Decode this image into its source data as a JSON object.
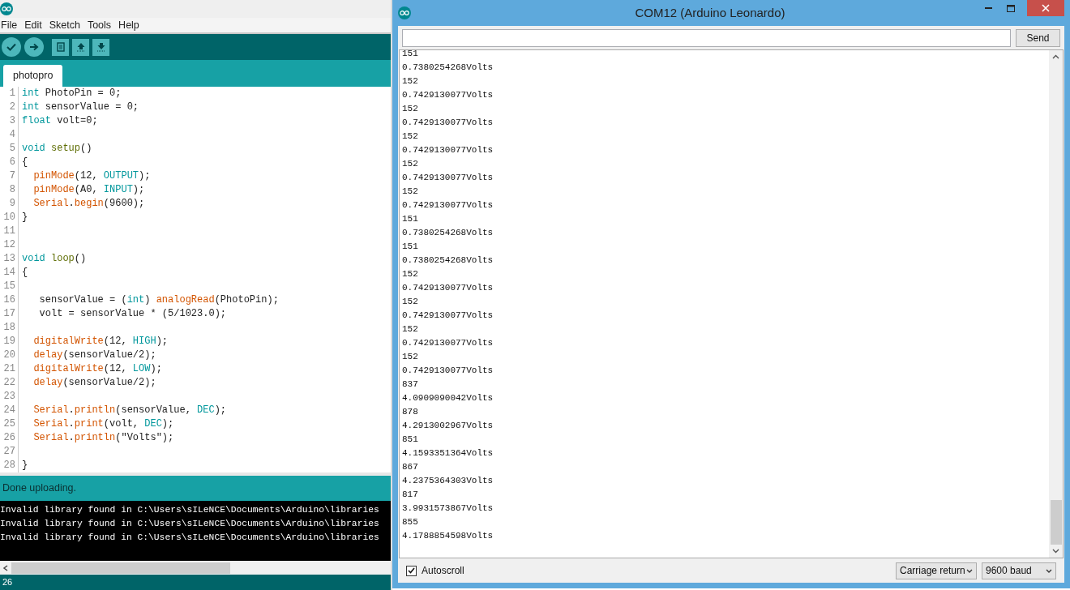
{
  "ide": {
    "menu": [
      "File",
      "Edit",
      "Sketch",
      "Tools",
      "Help"
    ],
    "tabs": [
      {
        "label": "photopro",
        "selected": true
      }
    ],
    "code": [
      {
        "number": "1",
        "tokens": [
          {
            "text": "int",
            "kind": "type"
          },
          {
            "text": " PhotoPin = 0;",
            "kind": "plain"
          }
        ]
      },
      {
        "number": "2",
        "tokens": [
          {
            "text": "int",
            "kind": "type"
          },
          {
            "text": " sensorValue = 0;",
            "kind": "plain"
          }
        ]
      },
      {
        "number": "3",
        "tokens": [
          {
            "text": "float",
            "kind": "type"
          },
          {
            "text": " volt=0;",
            "kind": "plain"
          }
        ]
      },
      {
        "number": "4"
      },
      {
        "number": "5",
        "tokens": [
          {
            "text": "void",
            "kind": "type"
          },
          {
            "text": " setup",
            "kind": "entry"
          },
          {
            "text": "()",
            "kind": "plain"
          }
        ]
      },
      {
        "number": "6",
        "tokens": [
          {
            "text": "{",
            "kind": "plain"
          }
        ]
      },
      {
        "number": "7",
        "tokens": [
          {
            "text": "  pinMode",
            "kind": "func"
          },
          {
            "text": "(12, ",
            "kind": "plain"
          },
          {
            "text": "OUTPUT",
            "kind": "const"
          },
          {
            "text": ");",
            "kind": "plain"
          }
        ]
      },
      {
        "number": "8",
        "tokens": [
          {
            "text": "  pinMode",
            "kind": "func"
          },
          {
            "text": "(A0, ",
            "kind": "plain"
          },
          {
            "text": "INPUT",
            "kind": "const"
          },
          {
            "text": ");",
            "kind": "plain"
          }
        ]
      },
      {
        "number": "9",
        "tokens": [
          {
            "text": "  Serial",
            "kind": "func"
          },
          {
            "text": ".",
            "kind": "plain"
          },
          {
            "text": "begin",
            "kind": "func"
          },
          {
            "text": "(9600);",
            "kind": "plain"
          }
        ]
      },
      {
        "number": "10",
        "tokens": [
          {
            "text": "}",
            "kind": "plain"
          }
        ]
      },
      {
        "number": "11"
      },
      {
        "number": "12"
      },
      {
        "number": "13",
        "tokens": [
          {
            "text": "void",
            "kind": "type"
          },
          {
            "text": " loop",
            "kind": "entry"
          },
          {
            "text": "()",
            "kind": "plain"
          }
        ]
      },
      {
        "number": "14",
        "tokens": [
          {
            "text": "{",
            "kind": "plain"
          }
        ]
      },
      {
        "number": "15"
      },
      {
        "number": "16",
        "tokens": [
          {
            "text": "   sensorValue = (",
            "kind": "plain"
          },
          {
            "text": "int",
            "kind": "type"
          },
          {
            "text": ") ",
            "kind": "plain"
          },
          {
            "text": "analogRead",
            "kind": "func"
          },
          {
            "text": "(PhotoPin);",
            "kind": "plain"
          }
        ]
      },
      {
        "number": "17",
        "tokens": [
          {
            "text": "   volt = sensorValue * (5/1023.0);",
            "kind": "plain"
          }
        ]
      },
      {
        "number": "18"
      },
      {
        "number": "19",
        "tokens": [
          {
            "text": "  digitalWrite",
            "kind": "func"
          },
          {
            "text": "(12, ",
            "kind": "plain"
          },
          {
            "text": "HIGH",
            "kind": "const"
          },
          {
            "text": ");",
            "kind": "plain"
          }
        ]
      },
      {
        "number": "20",
        "tokens": [
          {
            "text": "  delay",
            "kind": "func"
          },
          {
            "text": "(sensorValue/2);",
            "kind": "plain"
          }
        ]
      },
      {
        "number": "21",
        "tokens": [
          {
            "text": "  digitalWrite",
            "kind": "func"
          },
          {
            "text": "(12, ",
            "kind": "plain"
          },
          {
            "text": "LOW",
            "kind": "const"
          },
          {
            "text": ");",
            "kind": "plain"
          }
        ]
      },
      {
        "number": "22",
        "tokens": [
          {
            "text": "  delay",
            "kind": "func"
          },
          {
            "text": "(sensorValue/2);",
            "kind": "plain"
          }
        ]
      },
      {
        "number": "23"
      },
      {
        "number": "24",
        "tokens": [
          {
            "text": "  Serial",
            "kind": "func"
          },
          {
            "text": ".",
            "kind": "plain"
          },
          {
            "text": "println",
            "kind": "func"
          },
          {
            "text": "(sensorValue, ",
            "kind": "plain"
          },
          {
            "text": "DEC",
            "kind": "const"
          },
          {
            "text": ");",
            "kind": "plain"
          }
        ]
      },
      {
        "number": "25",
        "tokens": [
          {
            "text": "  Serial",
            "kind": "func"
          },
          {
            "text": ".",
            "kind": "plain"
          },
          {
            "text": "print",
            "kind": "func"
          },
          {
            "text": "(volt, ",
            "kind": "plain"
          },
          {
            "text": "DEC",
            "kind": "const"
          },
          {
            "text": ");",
            "kind": "plain"
          }
        ]
      },
      {
        "number": "26",
        "tokens": [
          {
            "text": "  Serial",
            "kind": "func"
          },
          {
            "text": ".",
            "kind": "plain"
          },
          {
            "text": "println",
            "kind": "func"
          },
          {
            "text": "(\"Volts\");",
            "kind": "plain"
          }
        ]
      },
      {
        "number": "27"
      },
      {
        "number": "28",
        "tokens": [
          {
            "text": "}",
            "kind": "plain"
          }
        ]
      }
    ],
    "status": "Done uploading.",
    "console": [
      "Invalid library found in C:\\Users\\sILeNCE\\Documents\\Arduino\\libraries",
      "Invalid library found in C:\\Users\\sILeNCE\\Documents\\Arduino\\libraries",
      "Invalid library found in C:\\Users\\sILeNCE\\Documents\\Arduino\\libraries"
    ],
    "line_indicator": "26"
  },
  "serial_monitor": {
    "window": {
      "title": "COM12 (Arduino Leonardo)"
    },
    "send_button": "Send",
    "output": [
      "151",
      "0.7380254268Volts",
      "152",
      "0.7429130077Volts",
      "152",
      "0.7429130077Volts",
      "152",
      "0.7429130077Volts",
      "152",
      "0.7429130077Volts",
      "152",
      "0.7429130077Volts",
      "151",
      "0.7380254268Volts",
      "151",
      "0.7380254268Volts",
      "152",
      "0.7429130077Volts",
      "152",
      "0.7429130077Volts",
      "152",
      "0.7429130077Volts",
      "152",
      "0.7429130077Volts",
      "837",
      "4.0909090042Volts",
      "878",
      "4.2913002967Volts",
      "851",
      "4.1593351364Volts",
      "867",
      "4.2375364303Volts",
      "817",
      "3.9931573867Volts",
      "855",
      "4.1788854598Volts"
    ],
    "autoscroll": {
      "label": "Autoscroll",
      "checked": true
    },
    "line_ending": "Carriage return",
    "baud": "9600 baud"
  }
}
